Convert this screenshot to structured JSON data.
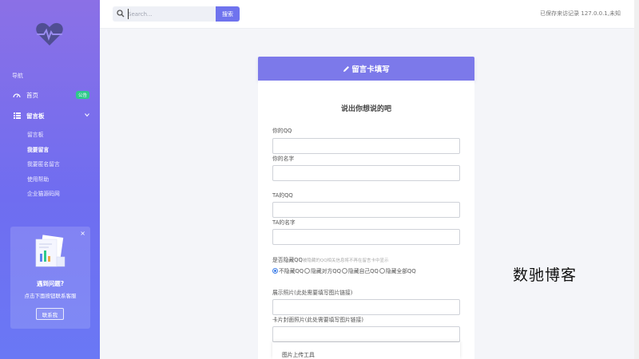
{
  "sidebar": {
    "nav_heading": "导航",
    "home_label": "首页",
    "home_badge": "公告",
    "board_label": "留言板",
    "sub_items": [
      "留言板",
      "我要留言",
      "我要匿名留言",
      "使用帮助",
      "企业猫源码网"
    ],
    "active_sub_index": 1,
    "promo": {
      "close": "×",
      "title": "遇到问题?",
      "subtitle": "点击下面按钮联系客服",
      "button": "联系我"
    }
  },
  "topbar": {
    "search_placeholder": "Search...",
    "search_button": "搜索",
    "visit_text": "已保存来访记录 127.0.0.1,未知"
  },
  "card": {
    "title": "留言卡填写",
    "heading": "说出你想说的吧",
    "fields": {
      "your_qq": "你的QQ",
      "your_name": "你的名字",
      "ta_qq": "TA的QQ",
      "ta_name": "TA的名字",
      "hide_label": "是否隐藏QQ",
      "hide_hint": "被隐藏的QQ相关信息将不再在留言卡中显示",
      "image_label": "展示照片(此处需要填写图片链接)",
      "cover_label": "卡片封面照片(此处需要填写图片链接)"
    },
    "radio_options": [
      "不隐藏QQ",
      "隐藏对方QQ",
      "隐藏自己QQ",
      "隐藏全部QQ"
    ],
    "radio_selected": 0,
    "upload_tool": "图片上传工具"
  },
  "watermark": "数驰博客",
  "colors": {
    "sidebar_top": "#8b70e6",
    "sidebar_bottom": "#6a78f5",
    "accent": "#7c79ea",
    "badge": "#2fc98b"
  },
  "icons": [
    "heart-pulse-icon",
    "dashboard-icon",
    "list-icon",
    "chevron-down-icon",
    "search-icon",
    "pen-icon",
    "close-icon"
  ]
}
